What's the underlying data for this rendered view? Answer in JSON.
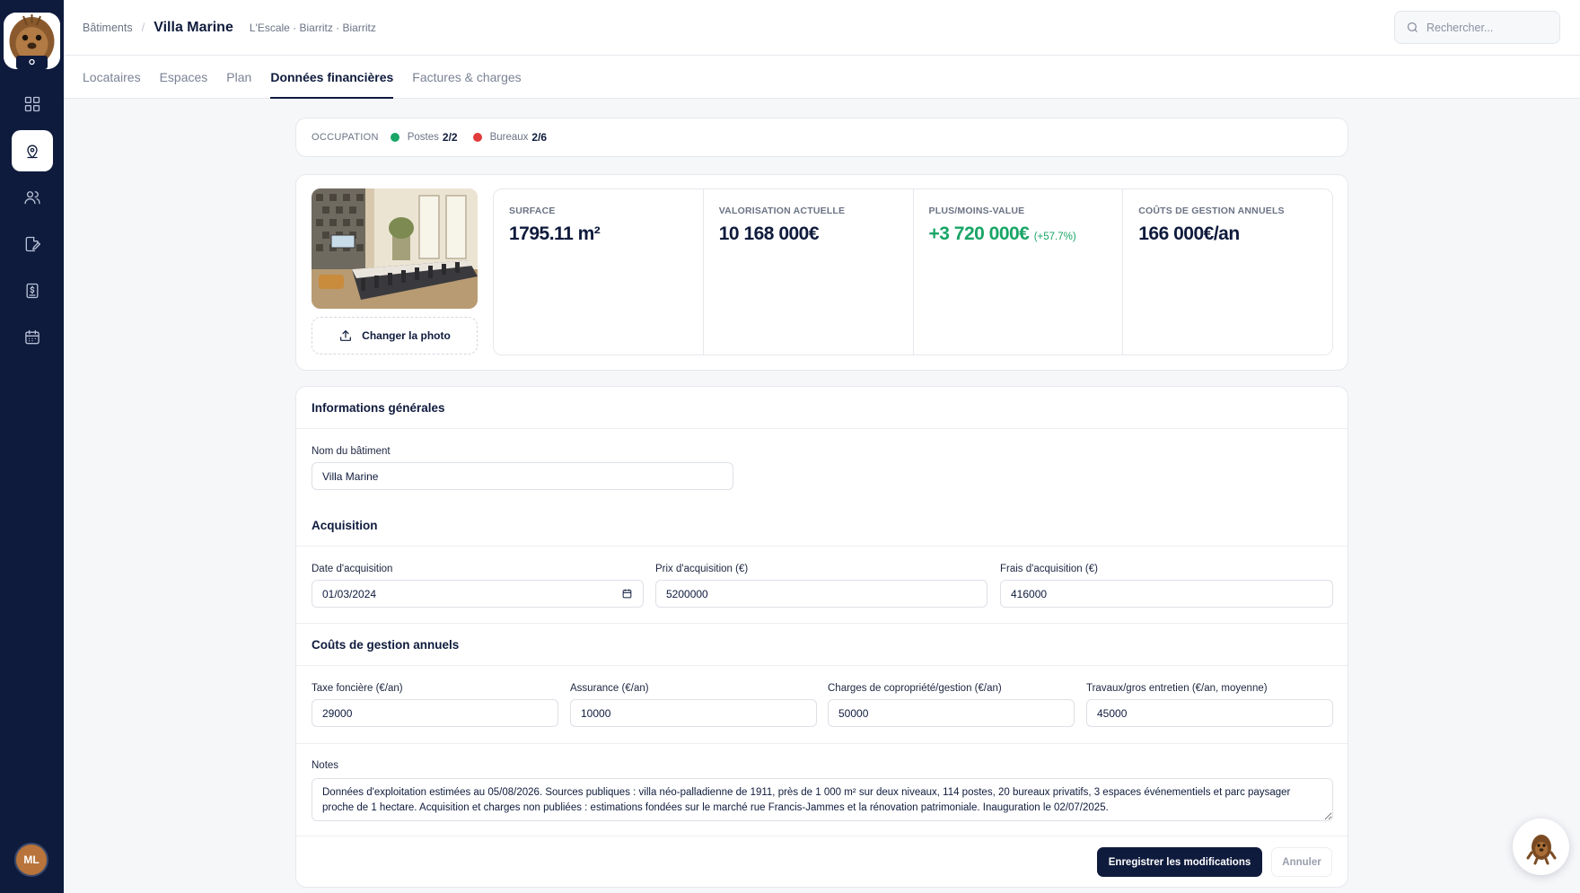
{
  "app": {
    "logo_icon": "mascot-logo-icon",
    "user_initials": "ML"
  },
  "sidebar": {
    "items": [
      {
        "icon": "dashboard-grid-icon",
        "active": false
      },
      {
        "icon": "building-pin-icon",
        "active": true
      },
      {
        "icon": "users-icon",
        "active": false
      },
      {
        "icon": "document-edit-icon",
        "active": false
      },
      {
        "icon": "invoice-dollar-icon",
        "active": false
      },
      {
        "icon": "calendar-icon",
        "active": false
      }
    ]
  },
  "header": {
    "breadcrumb_root": "Bâtiments",
    "separator": "/",
    "title": "Villa Marine",
    "subtitle": "L'Escale · Biarritz · Biarritz",
    "search_placeholder": "Rechercher..."
  },
  "tabs": [
    {
      "label": "Locataires",
      "active": false
    },
    {
      "label": "Espaces",
      "active": false
    },
    {
      "label": "Plan",
      "active": false
    },
    {
      "label": "Données financières",
      "active": true
    },
    {
      "label": "Factures & charges",
      "active": false
    }
  ],
  "occupancy": {
    "label": "OCCUPATION",
    "items": [
      {
        "name": "Postes",
        "value": "2/2",
        "color": "#18a566"
      },
      {
        "name": "Bureaux",
        "value": "2/6",
        "color": "#e23b3b"
      }
    ]
  },
  "summary": {
    "change_photo_label": "Changer la photo",
    "stats": [
      {
        "label": "SURFACE",
        "value": "1795.11 m²"
      },
      {
        "label": "VALORISATION ACTUELLE",
        "value": "10 168 000€"
      },
      {
        "label": "PLUS/MOINS-VALUE",
        "value": "+3 720 000€",
        "delta": "(+57.7%)"
      },
      {
        "label": "COÛTS DE GESTION ANNUELS",
        "value": "166 000€/an"
      }
    ]
  },
  "form": {
    "general": {
      "title": "Informations générales",
      "name_label": "Nom du bâtiment",
      "name_value": "Villa Marine"
    },
    "acquisition": {
      "title": "Acquisition",
      "date_label": "Date d'acquisition",
      "date_value": "01/03/2024",
      "price_label": "Prix d'acquisition (€)",
      "price_value": "5200000",
      "fees_label": "Frais d'acquisition (€)",
      "fees_value": "416000"
    },
    "costs": {
      "title": "Coûts de gestion annuels",
      "tax_label": "Taxe foncière (€/an)",
      "tax_value": "29000",
      "insurance_label": "Assurance (€/an)",
      "insurance_value": "10000",
      "charges_label": "Charges de copropriété/gestion (€/an)",
      "charges_value": "50000",
      "works_label": "Travaux/gros entretien (€/an, moyenne)",
      "works_value": "45000"
    },
    "notes": {
      "label": "Notes",
      "value": "Données d'exploitation estimées au 05/08/2026. Sources publiques : villa néo-palladienne de 1911, près de 1 000 m² sur deux niveaux, 114 postes, 20 bureaux privatifs, 3 espaces événementiels et parc paysager proche de 1 hectare. Acquisition et charges non publiées : estimations fondées sur le marché rue Francis-Jammes et la rénovation patrimoniale. Inauguration le 02/07/2025."
    },
    "save_label": "Enregistrer les modifications",
    "cancel_label": "Annuler"
  },
  "colors": {
    "sidebar": "#0f1b3d",
    "accent": "#0f1b3d",
    "positive": "#18a566",
    "negative": "#e23b3b"
  }
}
